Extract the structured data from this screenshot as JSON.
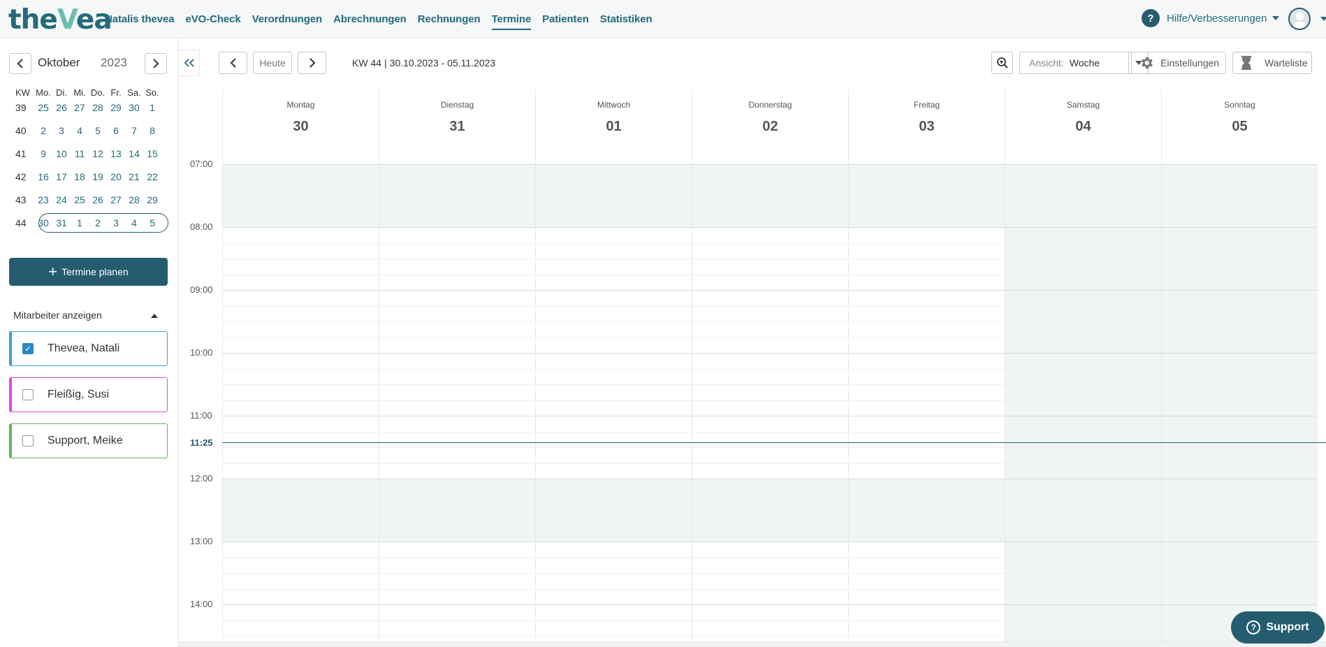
{
  "app": {
    "logo_pre": "the",
    "logo_v": "V",
    "logo_post": "ea"
  },
  "nav": {
    "items": [
      "Natalis thevea",
      "eVO-Check",
      "Verordnungen",
      "Abrechnungen",
      "Rechnungen",
      "Termine",
      "Patienten",
      "Statistiken"
    ],
    "active": "Termine",
    "help_label": "Hilfe/Verbesserungen",
    "help_icon": "?"
  },
  "mini_calendar": {
    "month": "Oktober",
    "year": "2023",
    "headers": [
      "KW",
      "Mo.",
      "Di.",
      "Mi.",
      "Do.",
      "Fr.",
      "Sa.",
      "So."
    ],
    "weeks": [
      {
        "kw": "39",
        "days": [
          "25",
          "26",
          "27",
          "28",
          "29",
          "30",
          "1"
        ]
      },
      {
        "kw": "40",
        "days": [
          "2",
          "3",
          "4",
          "5",
          "6",
          "7",
          "8"
        ]
      },
      {
        "kw": "41",
        "days": [
          "9",
          "10",
          "11",
          "12",
          "13",
          "14",
          "15"
        ]
      },
      {
        "kw": "42",
        "days": [
          "16",
          "17",
          "18",
          "19",
          "20",
          "21",
          "22"
        ]
      },
      {
        "kw": "43",
        "days": [
          "23",
          "24",
          "25",
          "26",
          "27",
          "28",
          "29"
        ]
      },
      {
        "kw": "44",
        "days": [
          "30",
          "31",
          "1",
          "2",
          "3",
          "4",
          "5"
        ],
        "selected": true
      }
    ]
  },
  "sidebar": {
    "plan_button": "Termine planen",
    "employees_header": "Mitarbeiter anzeigen",
    "employees": [
      {
        "name": "Thevea, Natali",
        "checked": true,
        "color": "#3d9ed8"
      },
      {
        "name": "Fleißig, Susi",
        "checked": false,
        "color": "#e046e0"
      },
      {
        "name": "Support, Meike",
        "checked": false,
        "color": "#5cb85c"
      }
    ]
  },
  "toolbar": {
    "today": "Heute",
    "kw": "KW 44",
    "range": "30.10.2023 - 05.11.2023",
    "view_label": "Ansicht:",
    "view_value": "Woche",
    "settings": "Einstellungen",
    "waitlist": "Warteliste"
  },
  "week": {
    "days": [
      {
        "name": "Montag",
        "date": "30"
      },
      {
        "name": "Dienstag",
        "date": "31"
      },
      {
        "name": "Mittwoch",
        "date": "01"
      },
      {
        "name": "Donnerstag",
        "date": "02"
      },
      {
        "name": "Freitag",
        "date": "03"
      },
      {
        "name": "Samstag",
        "date": "04"
      },
      {
        "name": "Sonntag",
        "date": "05"
      }
    ],
    "hours": [
      "07:00",
      "08:00",
      "09:00",
      "10:00",
      "11:00",
      "12:00",
      "13:00",
      "14:00"
    ],
    "now": "11:25"
  },
  "support": {
    "label": "Support"
  },
  "colors": {
    "brand": "#255c70",
    "accent": "#6cbfae",
    "shade": "#eef5f4"
  }
}
